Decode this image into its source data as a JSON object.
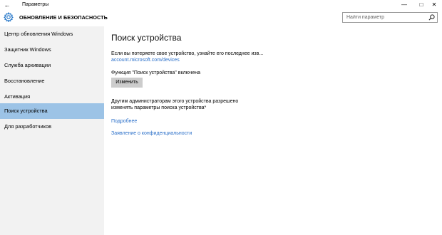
{
  "window": {
    "title": "Параметры",
    "back_glyph": "←",
    "minimize_glyph": "—",
    "maximize_glyph": "□",
    "close_glyph": "✕"
  },
  "header": {
    "section_title": "ОБНОВЛЕНИЕ И БЕЗОПАСНОСТЬ",
    "search_placeholder": "Найти параметр",
    "icons": [
      "gear-icon",
      "search-icon"
    ]
  },
  "sidebar": {
    "items": [
      {
        "label": "Центр обновления Windows",
        "selected": false
      },
      {
        "label": "Защитник Windows",
        "selected": false
      },
      {
        "label": "Служба архивации",
        "selected": false
      },
      {
        "label": "Восстановление",
        "selected": false
      },
      {
        "label": "Активация",
        "selected": false
      },
      {
        "label": "Поиск устройства",
        "selected": true
      },
      {
        "label": "Для разработчиков",
        "selected": false
      }
    ]
  },
  "main": {
    "title": "Поиск устройства",
    "lost_text": "Если вы потеряете свое устройство, узнайте его последнее изв...",
    "account_link": "account.microsoft.com/devices",
    "feature_status": "Функция \"Поиск устройства\" включена",
    "change_button": "Изменить",
    "admin_text_line1": "Другим администраторам этого устройства разрешено",
    "admin_text_line2": "изменять параметры поиска устройства*",
    "more_link": "Подробнее",
    "privacy_link": "Заявление о конфиденциальности"
  },
  "colors": {
    "sidebar_bg": "#f2f2f2",
    "selected_bg": "#9cc3e6",
    "link": "#2a6fc9",
    "button_bg": "#cccccc",
    "accent_icon": "#1f73c7"
  }
}
